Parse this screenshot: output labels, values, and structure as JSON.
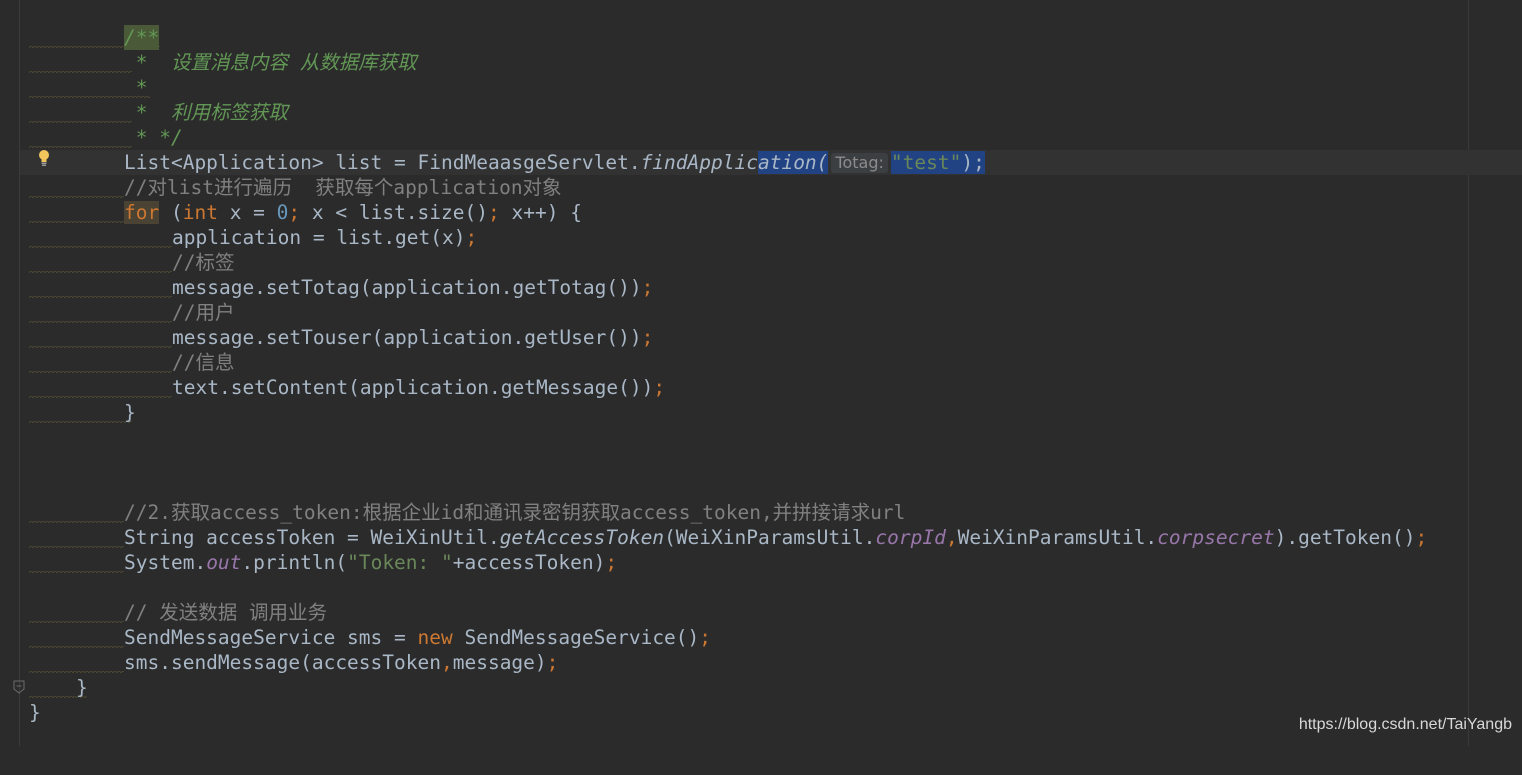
{
  "editor": {
    "lines": [
      {
        "doc_open": "/**"
      },
      {
        "doc": " *  设置消息内容 从数据库获取"
      },
      {
        "doc": " *"
      },
      {
        "doc": " *  利用标签获取"
      },
      {
        "doc": " * */"
      },
      {
        "a": "List<Application> list = FindMeaasgeServlet.",
        "b": "findApplic",
        "c": "ation(",
        "hint": "Totag:",
        "str": "\"test\"",
        "end": ");"
      },
      {
        "cm": "//对list进行遍历  获取每个application对象"
      },
      {
        "for_kw": "for",
        "p1": " (",
        "int_kw": "int",
        "p2": " x = ",
        "zero": "0",
        "semi1": ";",
        "p3": " x < list.size()",
        "semi2": ";",
        "p4": " x++) {"
      },
      {
        "a": "application = list.get(x)",
        "semi": ";"
      },
      {
        "cm": "//标签"
      },
      {
        "a": "message.setTotag(application.getTotag())",
        "semi": ";"
      },
      {
        "cm": "//用户"
      },
      {
        "a": "message.setTouser(application.getUser())",
        "semi": ";"
      },
      {
        "cm": "//信息"
      },
      {
        "a": "text.setContent(application.getMessage())",
        "semi": ";"
      },
      {
        "a": "}"
      },
      {},
      {},
      {},
      {
        "cm": "//2.获取access_token:根据企业id和通讯录密钥获取access_token,并拼接请求url"
      },
      {
        "a": "String accessToken = WeiXinUtil.",
        "m": "getAccessToken",
        "b": "(WeiXinParamsUtil.",
        "f1": "corpId",
        "comma": ",",
        "c": "WeiXinParamsUtil.",
        "f2": "corpsecret",
        "d": ").getToken()",
        "semi": ";"
      },
      {
        "a": "System.",
        "out": "out",
        "b": ".println(",
        "str": "\"Token: \"",
        "c": "+accessToken)",
        "semi": ";"
      },
      {},
      {
        "cm": "// 发送数据 调用业务"
      },
      {
        "a": "SendMessageService sms = ",
        "new_kw": "new",
        "b": " SendMessageService()",
        "semi": ";"
      },
      {
        "a": "sms.sendMessage(accessToken",
        "comma": ",",
        "b": "message)",
        "semi": ";"
      },
      {
        "a": "}"
      },
      {
        "a": "}"
      }
    ]
  },
  "icons": {
    "gutter_bulb": "intention-bulb-icon",
    "gutter_fold": "fold-marker-icon"
  },
  "watermark": "https://blog.csdn.net/TaiYangb",
  "colors": {
    "background": "#2b2b2b",
    "text": "#a9b7c6",
    "keyword": "#cc7832",
    "number": "#6897bb",
    "string": "#6a8759",
    "comment": "#808080",
    "doc_comment": "#629755",
    "field": "#9876aa",
    "selection": "#214283"
  }
}
